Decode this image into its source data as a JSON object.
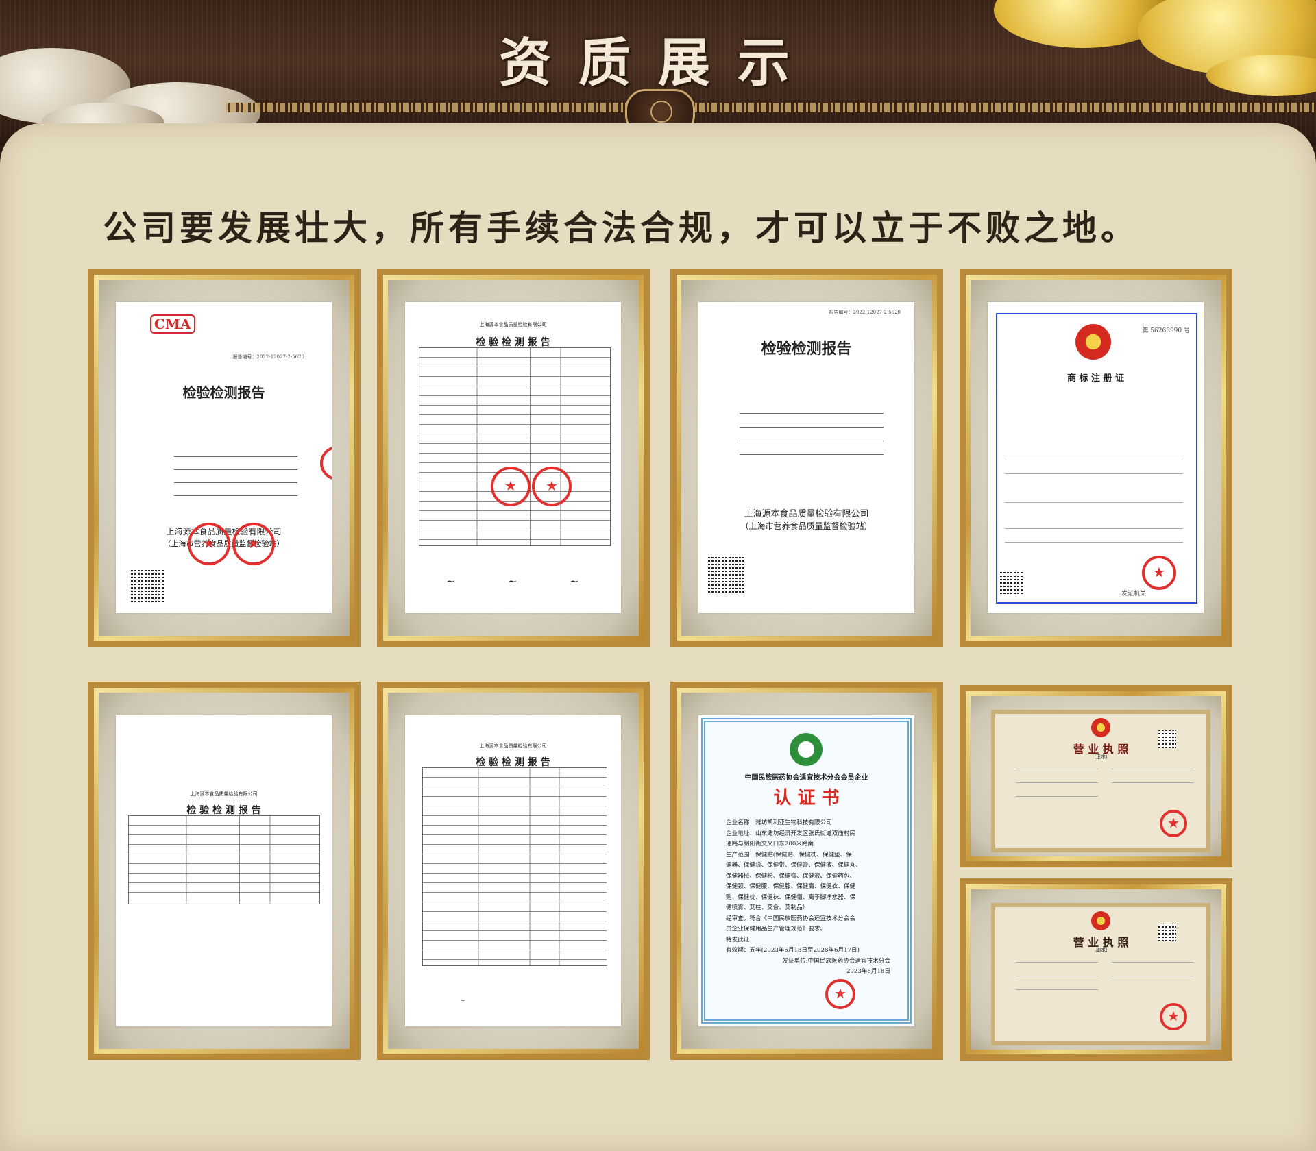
{
  "header": {
    "title": "资质展示"
  },
  "slogan": "公司要发展壮大，所有手续合法合规，才可以立于不败之地。",
  "docs": {
    "report1": {
      "cma": "CMA",
      "report_no": "报告编号：2022-12027-2-5620",
      "title": "检验检测报告",
      "company": "上海源本食品质量检验有限公司",
      "company_sub": "（上海市营养食品质量监督检验站）"
    },
    "report2": {
      "org": "上海源本食品质量检验有限公司",
      "title": "检 验 检 测 报 告"
    },
    "report3": {
      "report_no": "报告编号：2022-12027-2-5620",
      "title": "检验检测报告",
      "company": "上海源本食品质量检验有限公司",
      "company_sub": "（上海市营养食品质量监督检验站）"
    },
    "trademark": {
      "title": "商 标 注 册 证",
      "no": "第 56268990 号",
      "footer": "发证机关"
    },
    "report4": {
      "org": "上海源本食品质量检验有限公司",
      "title": "检 验 检 测 报 告"
    },
    "report5": {
      "org": "上海源本食品质量检验有限公司",
      "title": "检 验 检 测 报 告"
    },
    "cert": {
      "org": "中国民族医药协会适宜技术分会会员企业",
      "title": "认 证 书",
      "lines": [
        "企业名称：潍坊凯利亚生物科技有限公司",
        "企业地址：山东潍坊经济开发区张氏街道双庙村民",
        "通路与朝阳街交叉口东200米路南",
        "生产范围：保健贴(保健贴、保健枕、保健垫、保",
        "健器、保健袋、保健带、保健膏、保健液、保健丸、",
        "保健器械、保健粉、保健膏、保健液、保健药包、",
        "保健颈、保健腰、保健膝、保健肩、保健衣、保健",
        "贴、保健枕、保健袜、保健帽、离子脚净水器、保",
        "健喷雾、艾柱、艾条、艾制品）",
        "经审查，符合《中国民族医药协会适宜技术分会会",
        "员企业保健用品生产管理规范》要求。",
        "特发此证",
        "有效期：五年(2023年6月18日至2028年6月17日)",
        "发证单位:中国民族医药协会适宜技术分会",
        "2023年6月18日"
      ]
    },
    "biz1": {
      "title": "营 业 执 照",
      "sub": "（正本）"
    },
    "biz2": {
      "title": "营 业 执 照",
      "sub": "（副本）"
    }
  }
}
